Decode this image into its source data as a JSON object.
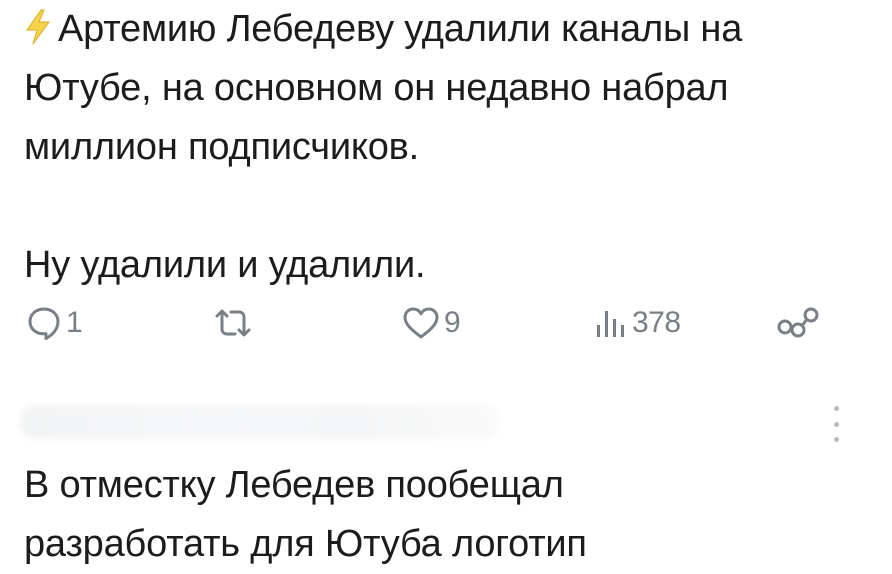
{
  "post": {
    "bolt_icon": "high-voltage-icon",
    "paragraph1_line1": "Артемию Лебедеву удалили каналы на",
    "paragraph1_line2": "Ютубе, на основном он недавно набрал",
    "paragraph1_line3": "миллион подписчиков.",
    "paragraph2": "Ну удалили и удалили."
  },
  "actions": {
    "reply_icon": "comment-icon",
    "reply_count": "1",
    "repost_icon": "repost-icon",
    "like_icon": "heart-icon",
    "like_count": "9",
    "views_icon": "views-icon",
    "views_count": "378",
    "share_icon": "share-icon"
  },
  "reply": {
    "more_icon": "vertical-dots-icon",
    "line1": "В отместку Лебедев пообещал",
    "line2": "разработать для Ютуба логотип"
  },
  "colors": {
    "text": "#1c1c1c",
    "icon": "#7a7f86",
    "bolt_fill": "#f6d24a"
  }
}
